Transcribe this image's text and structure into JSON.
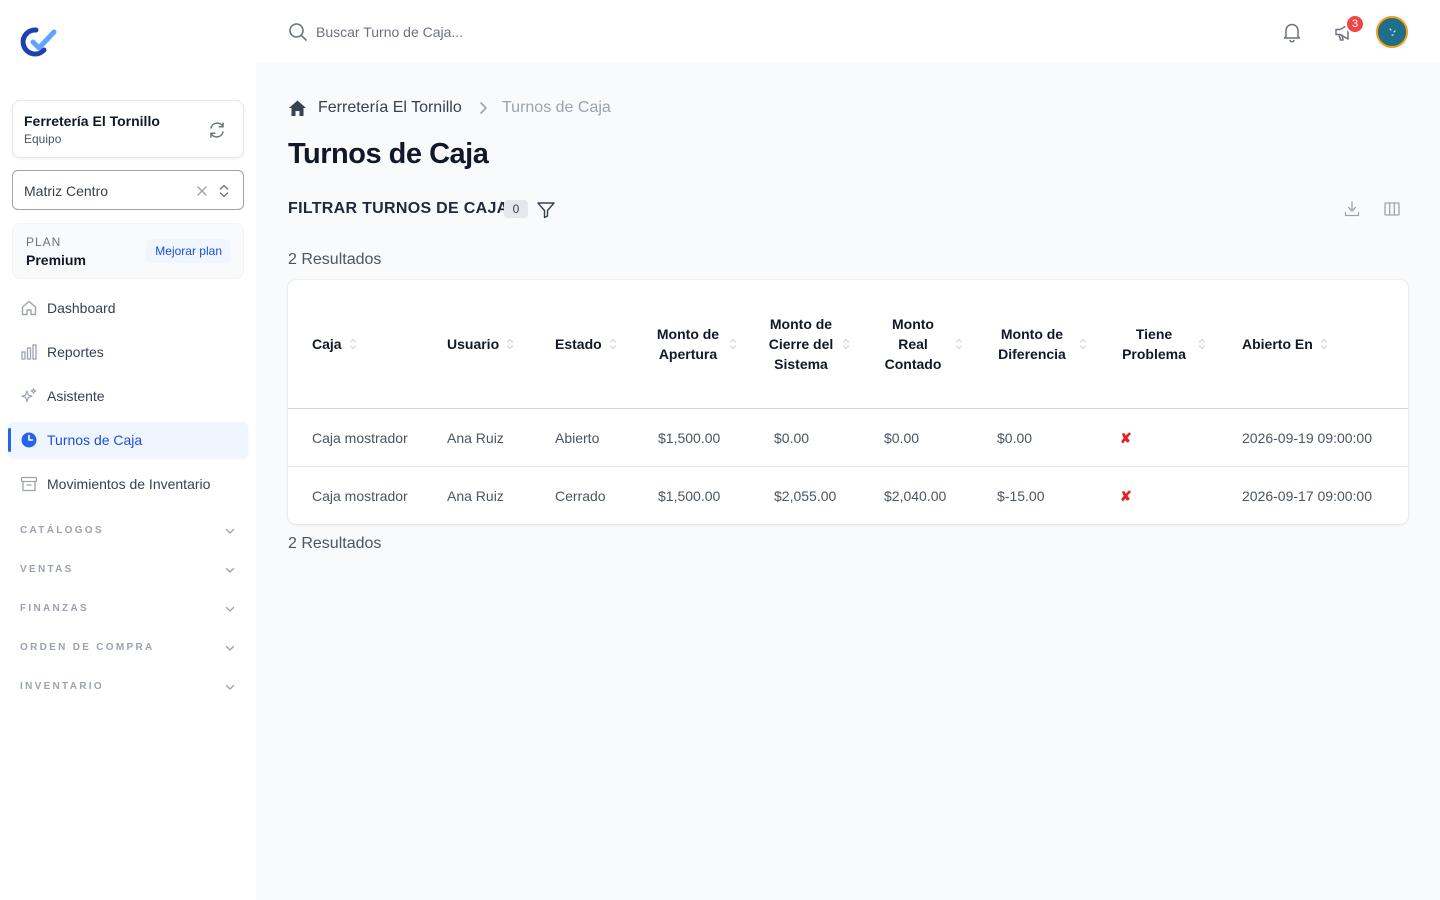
{
  "app": {
    "colors": {
      "accent": "#2563eb",
      "active_bg": "#eff6ff",
      "danger": "#ef4444"
    }
  },
  "sidebar": {
    "team": {
      "name": "Ferretería El Tornillo",
      "subtitle": "Equipo"
    },
    "branch": {
      "value": "Matriz Centro"
    },
    "plan": {
      "label": "PLAN",
      "name": "Premium",
      "upgrade_label": "Mejorar plan"
    },
    "items": [
      {
        "label": "Dashboard",
        "icon": "home-icon",
        "active": false
      },
      {
        "label": "Reportes",
        "icon": "bar-chart-icon",
        "active": false
      },
      {
        "label": "Asistente",
        "icon": "sparkles-icon",
        "active": false
      },
      {
        "label": "Turnos de Caja",
        "icon": "clock-icon",
        "active": true
      },
      {
        "label": "Movimientos de Inventario",
        "icon": "archive-icon",
        "active": false
      }
    ],
    "sections": [
      "CATÁLOGOS",
      "VENTAS",
      "FINANZAS",
      "ORDEN DE COMPRA",
      "INVENTARIO"
    ]
  },
  "topbar": {
    "search_placeholder": "Buscar Turno de Caja...",
    "notification_count": "3"
  },
  "breadcrumb": [
    "Ferretería El Tornillo",
    "Turnos de Caja"
  ],
  "page": {
    "title": "Turnos de Caja",
    "filter_title": "FILTRAR TURNOS DE CAJA",
    "filter_count": "0",
    "results_label": "2 Resultados"
  },
  "table": {
    "columns": [
      "Caja",
      "Usuario",
      "Estado",
      "Monto de Apertura",
      "Monto de Cierre del Sistema",
      "Monto Real Contado",
      "Monto de Diferencia",
      "Tiene Problema",
      "Abierto En"
    ],
    "rows": [
      [
        "Caja mostrador",
        "Ana Ruiz",
        "Abierto",
        "$1,500.00",
        "$0.00",
        "$0.00",
        "$0.00",
        "✘",
        "2026-09-19 09:00:00"
      ],
      [
        "Caja mostrador",
        "Ana Ruiz",
        "Cerrado",
        "$1,500.00",
        "$2,055.00",
        "$2,040.00",
        "$-15.00",
        "✘",
        "2026-09-17 09:00:00"
      ]
    ]
  }
}
